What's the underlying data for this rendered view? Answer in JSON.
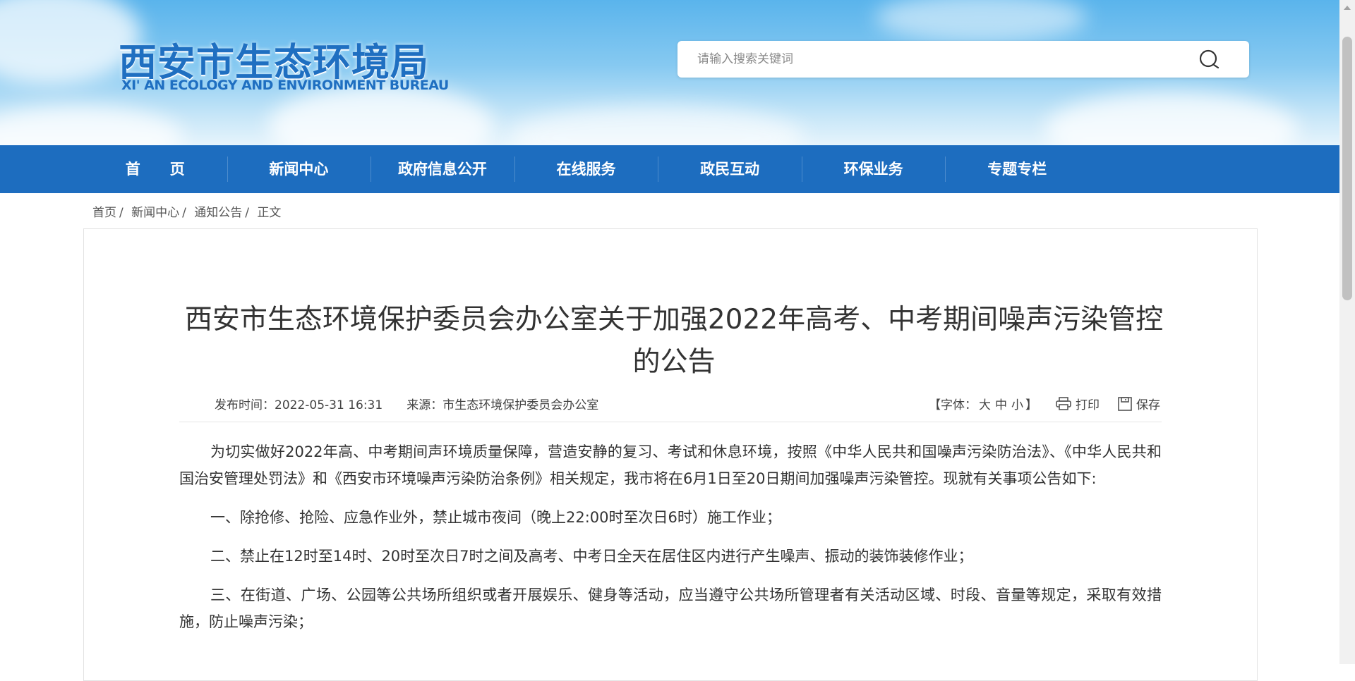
{
  "header": {
    "logo_cn": "西安市生态环境局",
    "logo_en": "XI' AN ECOLOGY AND ENVIRONMENT BUREAU",
    "search_placeholder": "请输入搜索关键词"
  },
  "nav": {
    "items": [
      {
        "label": "首　　页"
      },
      {
        "label": "新闻中心"
      },
      {
        "label": "政府信息公开"
      },
      {
        "label": "在线服务"
      },
      {
        "label": "政民互动"
      },
      {
        "label": "环保业务"
      },
      {
        "label": "专题专栏"
      }
    ]
  },
  "breadcrumb": {
    "items": [
      "首页",
      "新闻中心",
      "通知公告",
      "正文"
    ],
    "separator": "/"
  },
  "article": {
    "title": "西安市生态环境保护委员会办公室关于加强2022年高考、中考期间噪声污染管控的公告",
    "publish_label": "发布时间：",
    "publish_time": "2022-05-31 16:31",
    "source_label": "来源：",
    "source": "市生态环境保护委员会办公室",
    "font_size_open": "【字体：",
    "font_large": "大",
    "font_medium": "中",
    "font_small": "小",
    "font_size_close": "】",
    "print_label": "打印",
    "save_label": "保存",
    "paragraphs": [
      "为切实做好2022年高、中考期间声环境质量保障，营造安静的复习、考试和休息环境，按照《中华人民共和国噪声污染防治法》、《中华人民共和国治安管理处罚法》和《西安市环境噪声污染防治条例》相关规定，我市将在6月1日至20日期间加强噪声污染管控。现就有关事项公告如下:",
      "一、除抢修、抢险、应急作业外，禁止城市夜间（晚上22:00时至次日6时）施工作业；",
      "二、禁止在12时至14时、20时至次日7时之间及高考、中考日全天在居住区内进行产生噪声、振动的装饰装修作业；",
      "三、在街道、广场、公园等公共场所组织或者开展娱乐、健身等活动，应当遵守公共场所管理者有关活动区域、时段、音量等规定，采取有效措施，防止噪声污染；"
    ]
  },
  "colors": {
    "nav_bg": "#1d6dbf",
    "logo": "#1f6fc1"
  }
}
